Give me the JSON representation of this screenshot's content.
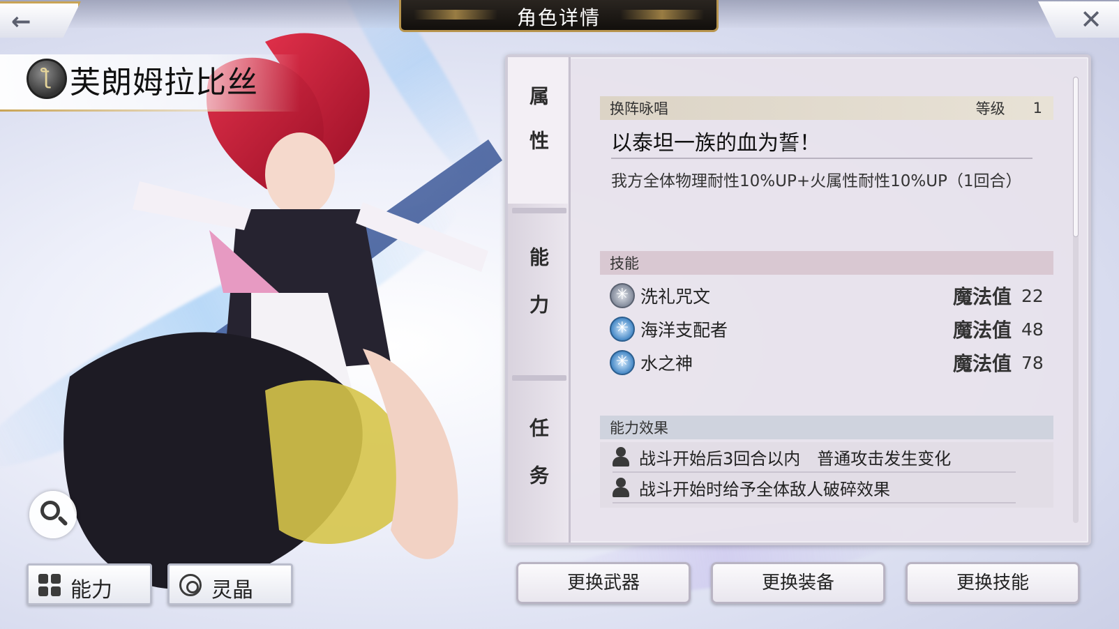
{
  "header": {
    "title": "角色详情"
  },
  "character": {
    "name": "芙朗姆拉比丝",
    "class_icon": "staff-icon"
  },
  "side_tabs": [
    "属性",
    "能力",
    "任务"
  ],
  "chant": {
    "header": "换阵咏唱",
    "level_label": "等级",
    "level_value": "1",
    "title": "以泰坦一族的血为誓！",
    "description": "我方全体物理耐性10%UP+火属性耐性10%UP（1回合）"
  },
  "skills": {
    "header": "技能",
    "items": [
      {
        "name": "洗礼咒文",
        "mp_label": "魔法值",
        "mp": "22",
        "icon": "gray-skill-icon"
      },
      {
        "name": "海洋支配者",
        "mp_label": "魔法值",
        "mp": "48",
        "icon": "water-skill-icon"
      },
      {
        "name": "水之神",
        "mp_label": "魔法值",
        "mp": "78",
        "icon": "water-skill-icon"
      }
    ]
  },
  "effects": {
    "header": "能力效果",
    "items": [
      "战斗开始后3回合以内　普通攻击发生变化",
      "战斗开始时给予全体敌人破碎效果"
    ]
  },
  "bottom_left": {
    "ability_label": "能力",
    "crystal_label": "灵晶"
  },
  "actions": {
    "weapon": "更换武器",
    "equipment": "更换装备",
    "skill": "更换技能"
  },
  "colors": {
    "gold": "#c9a455",
    "title_bg": "#1a1612",
    "panel_bg": "#e8e2ec"
  }
}
